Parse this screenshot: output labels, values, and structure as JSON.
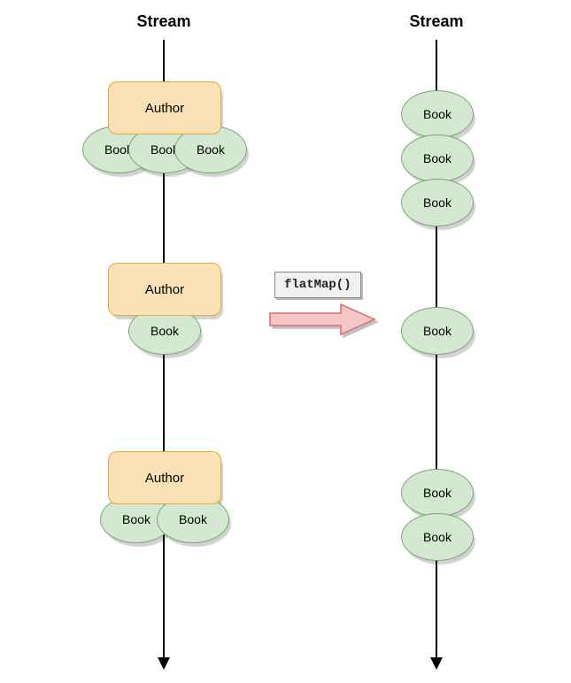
{
  "titles": {
    "left": "Stream",
    "right": "Stream"
  },
  "operation": "flatMap()",
  "left_groups": [
    {
      "author": "Author",
      "books": [
        "Book",
        "Book",
        "Book"
      ]
    },
    {
      "author": "Author",
      "books": [
        "Book"
      ]
    },
    {
      "author": "Author",
      "books": [
        "Book",
        "Book"
      ]
    }
  ],
  "right_books": [
    "Book",
    "Book",
    "Book",
    "Book",
    "Book",
    "Book"
  ],
  "chart_data": {
    "type": "diagram",
    "description": "Stream of Authors each holding Books is transformed via flatMap() into a single Stream of Books.",
    "input": [
      {
        "author": "Author",
        "book_count": 3
      },
      {
        "author": "Author",
        "book_count": 1
      },
      {
        "author": "Author",
        "book_count": 2
      }
    ],
    "operation": "flatMap()",
    "output_book_count": 6
  }
}
